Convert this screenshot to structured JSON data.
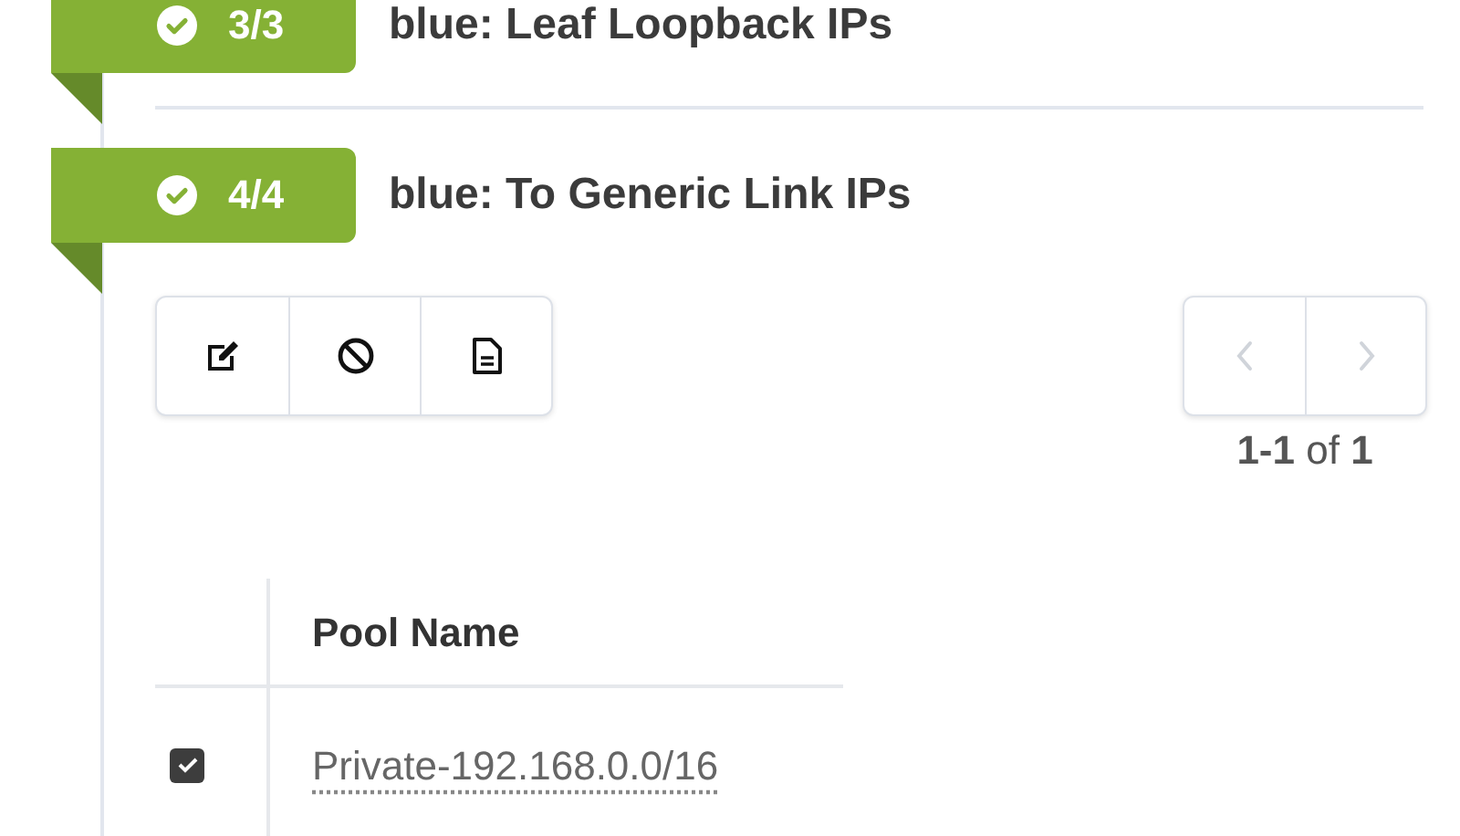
{
  "sections": [
    {
      "complete": true,
      "count": "3/3",
      "title": "blue: Leaf Loopback IPs"
    },
    {
      "complete": true,
      "count": "4/4",
      "title": "blue: To Generic Link IPs",
      "toolbar": [
        {
          "kind": "edit"
        },
        {
          "kind": "block"
        },
        {
          "kind": "document"
        }
      ],
      "pager": {
        "buttons": [
          {
            "kind": "prev",
            "disabled": true
          },
          {
            "kind": "next",
            "disabled": true
          }
        ],
        "summary": "**1-1** of **1**"
      },
      "table": {
        "columns": [
          "Pool Name"
        ],
        "rows": [
          {
            "checked": true,
            "pool_name": "Private-192.168.0.0/16"
          }
        ]
      }
    }
  ]
}
